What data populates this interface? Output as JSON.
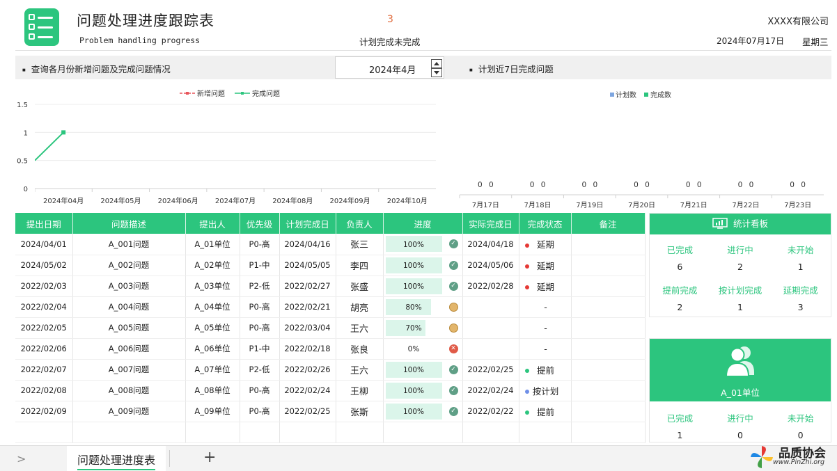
{
  "header": {
    "title": "问题处理进度跟踪表",
    "subtitle": "Problem handling progress",
    "pending_count": "3",
    "pending_label": "计划完成未完成",
    "company": "XXXX有限公司",
    "date": "2024年07月17日",
    "weekday": "星期三"
  },
  "query": {
    "label": "查询各月份新增问题及完成问题情况",
    "month_value": "2024年4月",
    "right_label": "计划近7日完成问题"
  },
  "colors": {
    "accent": "#2cc57e",
    "new_issue": "#e8545a",
    "done": "#2cc57e",
    "planned": "#7ea6e0",
    "late": "#e53935",
    "early": "#2cc57e",
    "ontime": "#6f8fe8"
  },
  "chart_data": [
    {
      "type": "line",
      "legend": [
        "新增问题",
        "完成问题"
      ],
      "legend_position": "top",
      "categories": [
        "2024年04月",
        "2024年05月",
        "2024年06月",
        "2024年07月",
        "2024年08月",
        "2024年09月",
        "2024年10月"
      ],
      "y_ticks": [
        "0",
        "0.5",
        "1",
        "1.5"
      ],
      "ylim": [
        0,
        1.5
      ],
      "series": [
        {
          "name": "完成问题",
          "x_start": 0.5,
          "values": [
            {
              "x": -0.5,
              "y": 0.5
            },
            {
              "x": 0,
              "y": 1
            }
          ]
        }
      ],
      "grid": true
    },
    {
      "type": "bar",
      "legend": [
        "计划数",
        "完成数"
      ],
      "legend_position": "top-right",
      "categories": [
        "7月17日",
        "7月18日",
        "7月19日",
        "7月20日",
        "7月21日",
        "7月22日",
        "7月23日"
      ],
      "series": [
        {
          "name": "计划数",
          "values": [
            0,
            0,
            0,
            0,
            0,
            0,
            0
          ]
        },
        {
          "name": "完成数",
          "values": [
            0,
            0,
            0,
            0,
            0,
            0,
            0
          ]
        }
      ]
    }
  ],
  "table": {
    "headers": [
      "提出日期",
      "问题描述",
      "提出人",
      "优先级",
      "计划完成日",
      "负责人",
      "进度",
      "实际完成日",
      "完成状态",
      "备注"
    ],
    "rows": [
      {
        "date": "2024/04/01",
        "desc": "A_001问题",
        "person": "A_01单位",
        "priority": "P0-高",
        "plan": "2024/04/16",
        "owner": "张三",
        "progress": "100%",
        "pct": 1.0,
        "icon": "check-icon",
        "actual": "2024/04/18",
        "status": "延期",
        "dot": "late"
      },
      {
        "date": "2024/05/02",
        "desc": "A_002问题",
        "person": "A_02单位",
        "priority": "P1-中",
        "plan": "2024/05/05",
        "owner": "李四",
        "progress": "100%",
        "pct": 1.0,
        "icon": "check-icon",
        "actual": "2024/05/06",
        "status": "延期",
        "dot": "late"
      },
      {
        "date": "2022/02/03",
        "desc": "A_003问题",
        "person": "A_03单位",
        "priority": "P2-低",
        "plan": "2022/02/27",
        "owner": "张盛",
        "progress": "100%",
        "pct": 1.0,
        "icon": "check-icon",
        "actual": "2022/02/28",
        "status": "延期",
        "dot": "late"
      },
      {
        "date": "2022/02/04",
        "desc": "A_004问题",
        "person": "A_04单位",
        "priority": "P0-高",
        "plan": "2022/02/21",
        "owner": "胡亮",
        "progress": "80%",
        "pct": 0.8,
        "icon": "pending-icon",
        "actual": "",
        "status": "-",
        "dot": ""
      },
      {
        "date": "2022/02/05",
        "desc": "A_005问题",
        "person": "A_05单位",
        "priority": "P0-高",
        "plan": "2022/03/04",
        "owner": "王六",
        "progress": "70%",
        "pct": 0.7,
        "icon": "pending-icon",
        "actual": "",
        "status": "-",
        "dot": ""
      },
      {
        "date": "2022/02/06",
        "desc": "A_006问题",
        "person": "A_06单位",
        "priority": "P1-中",
        "plan": "2022/02/18",
        "owner": "张良",
        "progress": "0%",
        "pct": 0.0,
        "icon": "cross-icon",
        "actual": "",
        "status": "-",
        "dot": ""
      },
      {
        "date": "2022/02/07",
        "desc": "A_007问题",
        "person": "A_07单位",
        "priority": "P2-低",
        "plan": "2022/02/26",
        "owner": "王六",
        "progress": "100%",
        "pct": 1.0,
        "icon": "check-icon",
        "actual": "2022/02/25",
        "status": "提前",
        "dot": "early"
      },
      {
        "date": "2022/02/08",
        "desc": "A_008问题",
        "person": "A_08单位",
        "priority": "P0-高",
        "plan": "2022/02/24",
        "owner": "王柳",
        "progress": "100%",
        "pct": 1.0,
        "icon": "check-icon",
        "actual": "2022/02/24",
        "status": "按计划",
        "dot": "ontime"
      },
      {
        "date": "2022/02/09",
        "desc": "A_009问题",
        "person": "A_09单位",
        "priority": "P0-高",
        "plan": "2022/02/25",
        "owner": "张斯",
        "progress": "100%",
        "pct": 1.0,
        "icon": "check-icon",
        "actual": "2022/02/22",
        "status": "提前",
        "dot": "early"
      }
    ]
  },
  "dashboard": {
    "title": "统计看板",
    "completed_label": "已完成",
    "completed": "6",
    "inprogress_label": "进行中",
    "inprogress": "2",
    "notstarted_label": "未开始",
    "notstarted": "1",
    "early_label": "提前完成",
    "early": "2",
    "ontime_label": "按计划完成",
    "ontime": "1",
    "late_label": "延期完成",
    "late": "3"
  },
  "unit_panel": {
    "name": "A_01单位",
    "completed_label": "已完成",
    "completed": "1",
    "inprogress_label": "进行中",
    "inprogress": "0",
    "notstarted_label": "未开始",
    "notstarted": "0"
  },
  "sheet": {
    "tab_name": "问题处理进度表",
    "add": "+"
  },
  "watermark": {
    "text": "品质协会",
    "url": "www.PinZhi.org"
  }
}
